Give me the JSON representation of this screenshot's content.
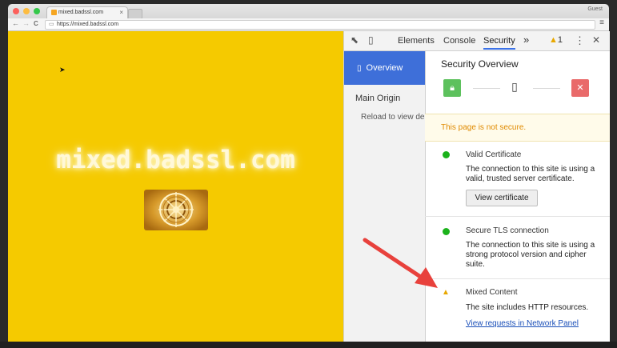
{
  "browser": {
    "tab_title": "mixed.badssl.com",
    "tab_close": "×",
    "profile": "Guest",
    "url": "https://mixed.badssl.com",
    "back": "←",
    "forward": "→",
    "reload": "C",
    "menu": "≡"
  },
  "page": {
    "title": "mixed.badssl.com"
  },
  "devtools": {
    "tabs": [
      "Elements",
      "Console",
      "Security"
    ],
    "active_tab": "Security",
    "more": "»",
    "warning_count": "1",
    "kebab": "⋮",
    "close": "✕",
    "sidebar": {
      "overview": "Overview",
      "main_origin": "Main Origin",
      "reload_hint": "Reload to view de"
    },
    "security": {
      "heading": "Security Overview",
      "not_secure": "This page is not secure.",
      "items": [
        {
          "status": "secure",
          "title": "Valid Certificate",
          "desc": "The connection to this site is using a valid, trusted server certificate.",
          "button": "View certificate"
        },
        {
          "status": "secure",
          "title": "Secure TLS connection",
          "desc": "The connection to this site is using a strong protocol version and cipher suite."
        },
        {
          "status": "warning",
          "title": "Mixed Content",
          "desc": "The site includes HTTP resources.",
          "link": "View requests in Network Panel"
        }
      ]
    }
  },
  "colors": {
    "page_bg": "#f5ca00",
    "secure_green": "#1bb21b",
    "warning_amber": "#e8a800",
    "active_blue": "#3e6fd9",
    "arrow_red": "#e8413c"
  }
}
